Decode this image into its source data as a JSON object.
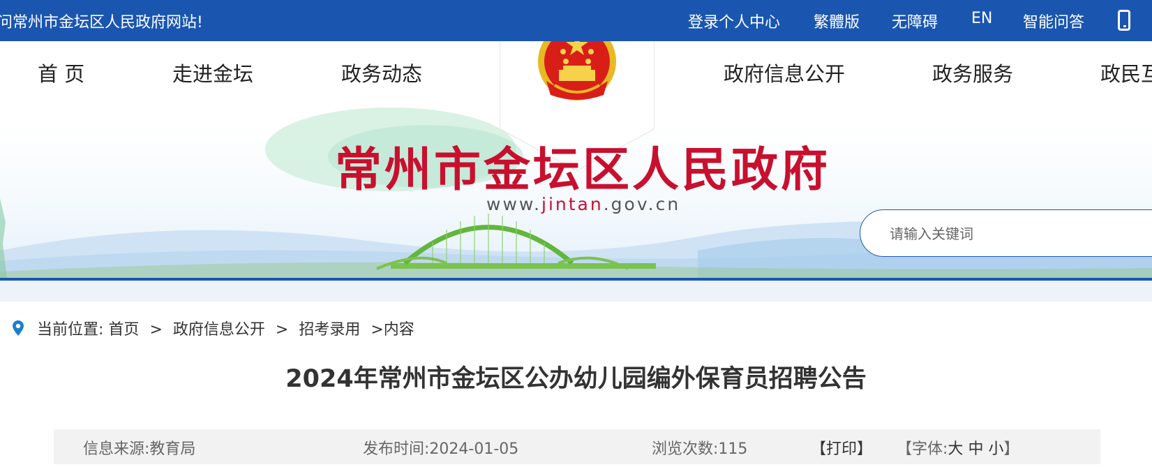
{
  "topbar": {
    "welcome": "问常州市金坛区人民政府网站!",
    "links": [
      "登录个人中心",
      "繁體版",
      "无障碍",
      "EN",
      "智能问答"
    ]
  },
  "nav": {
    "left": [
      "首 页",
      "走进金坛",
      "政务动态"
    ],
    "right": [
      "政府信息公开",
      "政务服务",
      "政民互动"
    ]
  },
  "header": {
    "site_name": "常州市金坛区人民政府",
    "url_prefix": "www.",
    "url_accent": "jintan",
    "url_suffix": ".gov.cn"
  },
  "search": {
    "placeholder": "请输入关键词"
  },
  "breadcrumb": {
    "label": "当前位置:",
    "items": [
      "首页",
      "政府信息公开",
      "招考录用",
      "内容"
    ],
    "separator": ">"
  },
  "article": {
    "title": "2024年常州市金坛区公办幼儿园编外保育员招聘公告",
    "source": "信息来源:教育局",
    "published": "发布时间:2024-01-05",
    "views": "浏览次数:115",
    "print": "【打印】",
    "font_label": "【字体:",
    "font_large": "大",
    "font_medium": "中",
    "font_small": "小",
    "font_close": "】"
  },
  "colors": {
    "primary": "#1a56b0",
    "title_red": "#c8102e",
    "bridge_green": "#6cc04a"
  }
}
